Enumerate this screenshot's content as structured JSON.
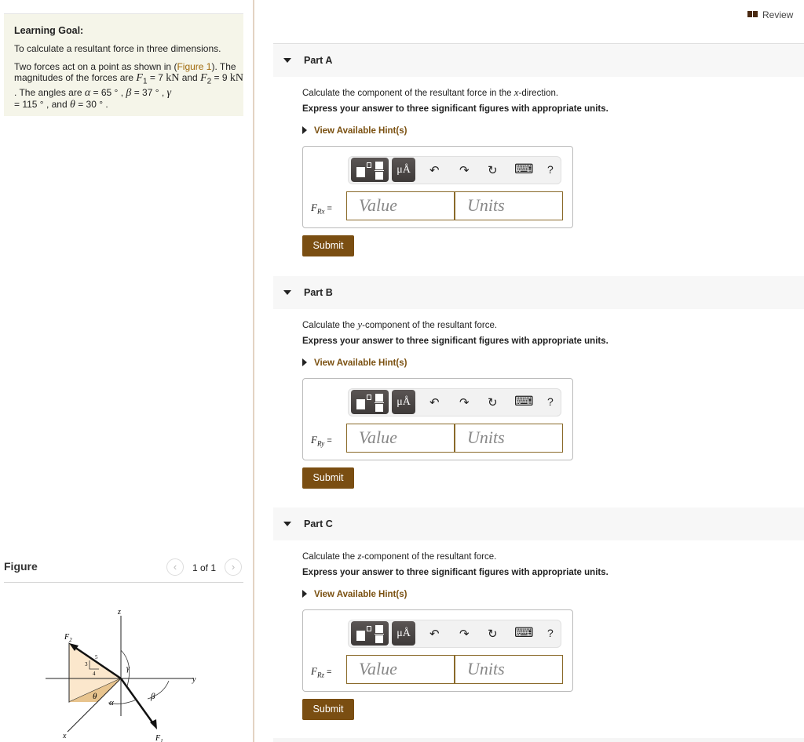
{
  "header": {
    "review_label": "Review"
  },
  "learning_goal": {
    "heading": "Learning Goal:",
    "goal_text": "To calculate a resultant force in three dimensions.",
    "p1": "Two forces act on a point as shown in (",
    "figure_link": "Figure 1",
    "p2": "). The magnitudes of the forces are ",
    "F1": "F",
    "F1_sub": "1",
    "F1_val": " = 7 ",
    "kN": "kN",
    "and": " and ",
    "F2": "F",
    "F2_sub": "2",
    "F2_val": " = 9 ",
    "p3": " . The angles are ",
    "alpha": "α",
    "alpha_val": " = 65 ° , ",
    "beta": "β",
    "beta_val": " = 37 ° , ",
    "gamma": "γ",
    "gamma_val": " = 115 ° , and ",
    "theta": "θ",
    "theta_val": " = 30 ° ."
  },
  "figure": {
    "title": "Figure",
    "pagination": "1 of 1",
    "prev_icon": "‹",
    "next_icon": "›",
    "labels": {
      "z": "z",
      "y": "y",
      "x": "x",
      "F1": "F",
      "F1_sub": "1",
      "F2": "F",
      "F2_sub": "2",
      "three": "3",
      "four": "4",
      "five": "5",
      "theta": "θ",
      "alpha": "α",
      "beta": "β",
      "gamma": "γ"
    }
  },
  "toolbar": {
    "units_label": "μÅ",
    "undo": "↶",
    "redo": "↷",
    "reset": "↻",
    "keyboard": "⌨",
    "help": "?"
  },
  "parts": [
    {
      "title": "Part A",
      "q_pre": "Calculate the component of the resultant force in the ",
      "var": "x",
      "q_post": "-direction.",
      "express": "Express your answer to three significant figures with appropriate units.",
      "hint": "View Available Hint(s)",
      "label": "F",
      "label_sub": "Rx",
      "eq": " =",
      "value_placeholder": "Value",
      "units_placeholder": "Units",
      "submit": "Submit"
    },
    {
      "title": "Part B",
      "q_pre": "Calculate the ",
      "var": "y",
      "q_post": "-component of the resultant force.",
      "express": "Express your answer to three significant figures with appropriate units.",
      "hint": "View Available Hint(s)",
      "label": "F",
      "label_sub": "Ry",
      "eq": " =",
      "value_placeholder": "Value",
      "units_placeholder": "Units",
      "submit": "Submit"
    },
    {
      "title": "Part C",
      "q_pre": "Calculate the ",
      "var": "z",
      "q_post": "-component of the resultant force.",
      "express": "Express your answer to three significant figures with appropriate units.",
      "hint": "View Available Hint(s)",
      "label": "F",
      "label_sub": "Rz",
      "eq": " =",
      "value_placeholder": "Value",
      "units_placeholder": "Units",
      "submit": "Submit"
    }
  ]
}
